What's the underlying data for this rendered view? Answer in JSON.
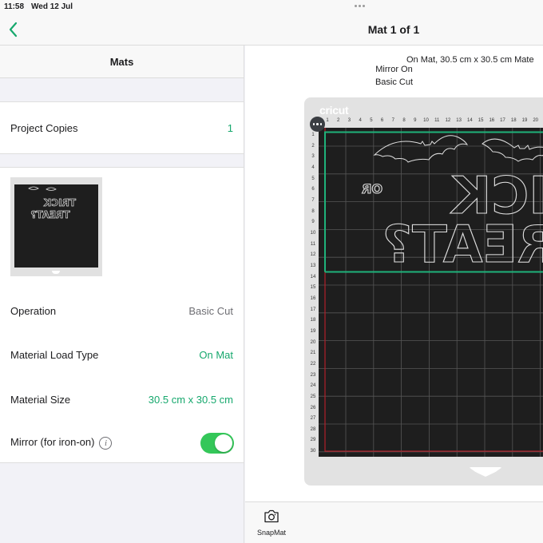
{
  "status_bar": {
    "time": "11:58",
    "date": "Wed 12 Jul"
  },
  "nav": {
    "title": "Mat 1 of 1",
    "back_icon": "chevron-left-icon"
  },
  "left_panel": {
    "header": "Mats",
    "project_copies": {
      "label": "Project Copies",
      "value": "1"
    },
    "settings": [
      {
        "label": "Operation",
        "value": "Basic Cut",
        "value_color": "gray"
      },
      {
        "label": "Material Load Type",
        "value": "On Mat",
        "value_color": "green"
      },
      {
        "label": "Material Size",
        "value": "30.5 cm x 30.5 cm",
        "value_color": "green"
      }
    ],
    "mirror": {
      "label": "Mirror (for iron-on)",
      "info_icon": "i",
      "enabled": true
    }
  },
  "preview": {
    "info_lines": [
      "On Mat, 30.5 cm x 30.5 cm Mate",
      "Mirror On",
      "Basic Cut"
    ],
    "mat_brand": "cricut",
    "column_ticks": [
      "1",
      "2",
      "3",
      "4",
      "5",
      "6",
      "7",
      "8",
      "9",
      "10",
      "11",
      "12",
      "13",
      "14",
      "15",
      "16",
      "17",
      "18",
      "19",
      "20"
    ],
    "row_ticks": [
      "1",
      "2",
      "3",
      "4",
      "5",
      "6",
      "7",
      "8",
      "9",
      "10",
      "11",
      "12",
      "13",
      "14",
      "15",
      "16",
      "17",
      "18",
      "19",
      "20",
      "21",
      "22",
      "23",
      "24",
      "25",
      "26",
      "27",
      "28",
      "29",
      "30"
    ],
    "design_text": {
      "line1": "TRICK",
      "small": "OR",
      "line2": "TREAT?"
    }
  },
  "bottom_bar": {
    "snapmat_label": "SnapMat"
  },
  "colors": {
    "accent_green": "#16a86d",
    "toggle_green": "#34c759",
    "selection_green": "#1fb27a",
    "mat_black": "#1e1e1e",
    "cut_line_red": "#b0202a"
  }
}
